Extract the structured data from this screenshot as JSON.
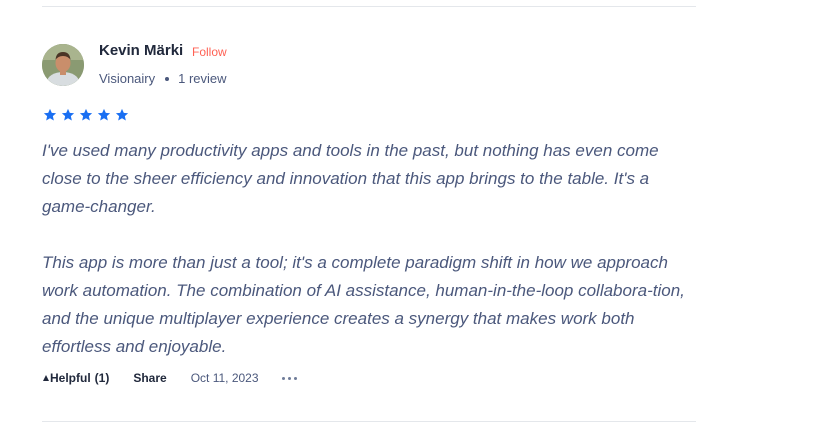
{
  "review": {
    "author": {
      "name": "Kevin Märki",
      "follow_label": "Follow",
      "headline": "Visionairy",
      "review_count": "1 review"
    },
    "rating": 5,
    "star_color": "#1a6ff2",
    "paragraphs": [
      "I've used many productivity apps and tools in the past, but nothing has even come close to the sheer efficiency and innovation that this app brings to the table. It's a game-changer.",
      "This app is more than just a tool; it's a complete paradigm shift in how we approach work automation. The combination of AI assistance, human-in-the-loop collabora-tion, and the unique multiplayer experience creates a synergy that makes work both effortless and enjoyable."
    ],
    "actions": {
      "helpful_label": "Helpful",
      "helpful_count": "(1)",
      "share_label": "Share",
      "date": "Oct 11, 2023",
      "more_icon": "ellipsis-icon"
    }
  }
}
